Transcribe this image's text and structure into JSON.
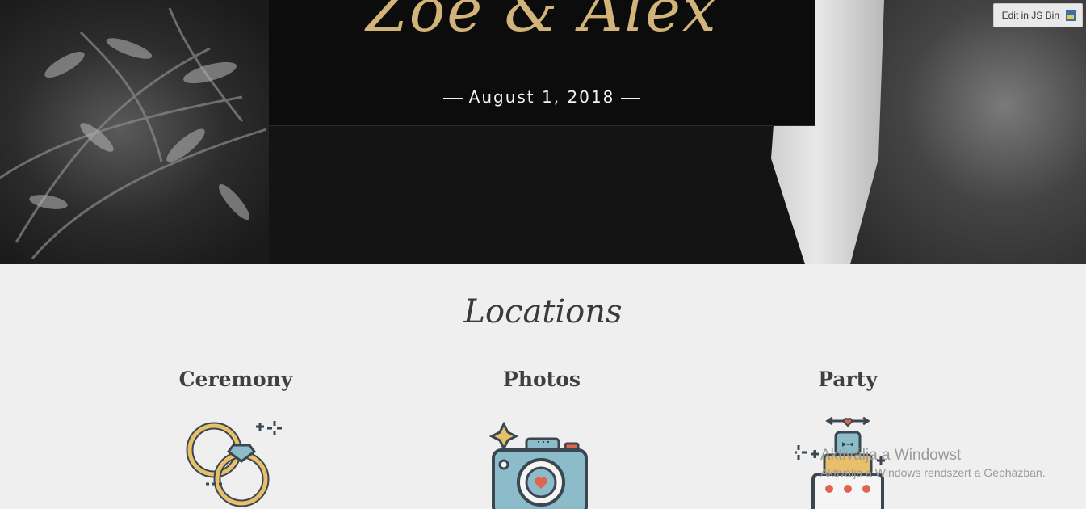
{
  "hero": {
    "couple_title": "Zoe & Alex",
    "date": "August 1, 2018"
  },
  "jsbin": {
    "label": "Edit in JS Bin"
  },
  "locations": {
    "title": "Locations",
    "columns": [
      {
        "label": "Ceremony",
        "icon": "rings-icon"
      },
      {
        "label": "Photos",
        "icon": "camera-icon"
      },
      {
        "label": "Party",
        "icon": "cake-icon"
      }
    ]
  },
  "watermark": {
    "line1": "Aktiválja a Windowst",
    "line2": "Aktiválja a Windows rendszert a Gépházban."
  },
  "colors": {
    "gold": "#d2b47a",
    "icon_blue": "#8cbcca",
    "icon_dark": "#3a4650",
    "icon_yellow": "#e8c06a",
    "icon_red": "#e0654f"
  }
}
